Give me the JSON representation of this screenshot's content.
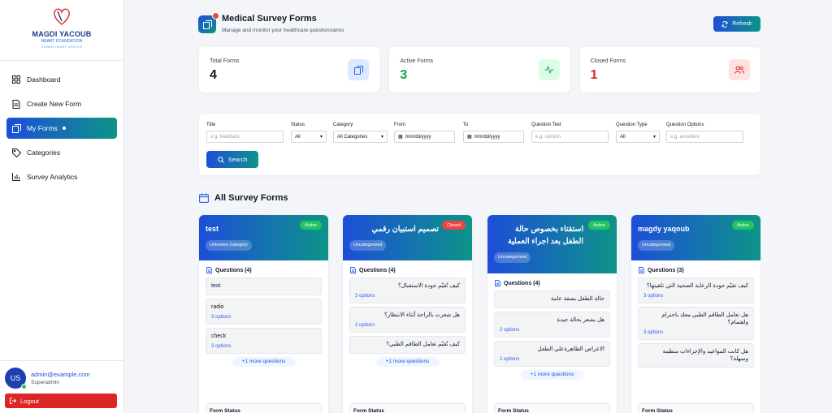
{
  "brand": {
    "name": "MAGDI YACOUB",
    "sub": "HEART FOUNDATION",
    "sub2": "ASWAN HEART CENTER"
  },
  "nav": [
    {
      "label": "Dashboard",
      "icon": "grid-icon"
    },
    {
      "label": "Create New Form",
      "icon": "document-icon"
    },
    {
      "label": "My Forms",
      "icon": "forms-icon",
      "active": true
    },
    {
      "label": "Categories",
      "icon": "tag-icon"
    },
    {
      "label": "Survey Analytics",
      "icon": "bar-chart-icon"
    }
  ],
  "user": {
    "initials": "US",
    "email": "admin@example.com",
    "role": "Superadmin",
    "logout": "Logout"
  },
  "header": {
    "title": "Medical Survey Forms",
    "subtitle": "Manage and monitor your healthcare questionnaires",
    "refresh": "Refresh"
  },
  "stats": [
    {
      "label": "Total Forms",
      "value": "4",
      "color": "#111827"
    },
    {
      "label": "Active Forms",
      "value": "3",
      "color": "#16a34a"
    },
    {
      "label": "Closed Forms",
      "value": "1",
      "color": "#dc2626"
    }
  ],
  "filters": {
    "title_label": "Title",
    "title_placeholder": "e.g. feedback",
    "status_label": "Status",
    "status_value": "All",
    "category_label": "Category",
    "category_value": "All Categories",
    "from_label": "From",
    "from_value": "mm/dd/yyyy",
    "to_label": "To",
    "to_value": "mm/dd/yyyy",
    "question_text_label": "Question Text",
    "question_text_placeholder": "e.g. opinion",
    "question_type_label": "Question Type",
    "question_type_value": "All",
    "question_options_label": "Question Options",
    "question_options_placeholder": "e.g. excellent",
    "search": "Search"
  },
  "section_title": "All Survey Forms",
  "cards": [
    {
      "title": "test",
      "rtl": false,
      "status": "Active",
      "category": "Unknown Category",
      "questions_label": "Questions (4)",
      "questions": [
        {
          "text": "text",
          "options": ""
        },
        {
          "text": "radio",
          "options": "3 options"
        },
        {
          "text": "check",
          "options": "3 options"
        }
      ],
      "more": "+1 more questions",
      "form_status": "Form Status"
    },
    {
      "title": "تصميم استبيان رقمي",
      "rtl": true,
      "status": "Closed",
      "category": "Uncategorized",
      "questions_label": "Questions (4)",
      "questions": [
        {
          "text": "كيف تُقيّم جودة الاستقبال؟",
          "options": "3 options"
        },
        {
          "text": "هل شعرت بالراحة أثناء الانتظار؟",
          "options": "2 options"
        },
        {
          "text": "كيف تُقيّم تعامل الطاقم الطبي؟",
          "options": ""
        }
      ],
      "more": "+1 more questions",
      "form_status": "Form Status"
    },
    {
      "title": "استقتاء بخصوص حالة الطفل بعد اجراء العملية",
      "rtl": true,
      "status": "Active",
      "category": "Uncategorized",
      "questions_label": "Questions (4)",
      "questions": [
        {
          "text": "حالة الطفل بصفة عامة",
          "options": ""
        },
        {
          "text": "هل يشعر بحالة جيدة",
          "options": "2 options"
        },
        {
          "text": "الاعراض الظاهرةعلي الطفل",
          "options": "2 options"
        }
      ],
      "more": "+1 more questions",
      "form_status": "Form Status"
    },
    {
      "title": "magdy yaqoub",
      "rtl": false,
      "status": "Active",
      "category": "Uncategorized",
      "questions_label": "Questions (3)",
      "questions": [
        {
          "text": "كيف تقيّم جودة الرعاية الصحية التي تلقيتها؟",
          "options": "3 options"
        },
        {
          "text": "هل تعامل الطاقم الطبي معك باحترام واهتمام؟",
          "options": "3 options"
        },
        {
          "text": "هل كانت المواعيد والإجراءات منظمة وسهلة؟",
          "options": ""
        }
      ],
      "more": "",
      "form_status": "Form Status"
    }
  ],
  "colors": {
    "accent_start": "#1d4ed8",
    "accent_end": "#0d9488",
    "active": "#22c55e",
    "closed": "#ef4444"
  }
}
